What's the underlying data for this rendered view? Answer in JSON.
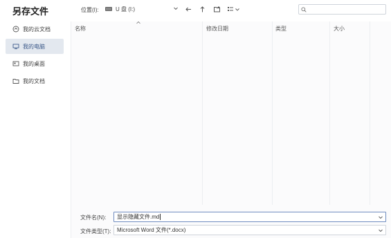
{
  "dialog": {
    "title": "另存文件"
  },
  "sidebar": {
    "items": [
      {
        "label": "我的云文档",
        "icon": "cloud-icon",
        "active": false
      },
      {
        "label": "我的电脑",
        "icon": "computer-icon",
        "active": true
      },
      {
        "label": "我的桌面",
        "icon": "desktop-icon",
        "active": false
      },
      {
        "label": "我的文档",
        "icon": "folder-icon",
        "active": false
      }
    ]
  },
  "toolbar": {
    "location_label": "位置(I):",
    "location_value": "U 盘 (I:)",
    "search_placeholder": ""
  },
  "columns": [
    {
      "label": "名称"
    },
    {
      "label": "修改日期"
    },
    {
      "label": "类型"
    },
    {
      "label": "大小"
    }
  ],
  "bottom": {
    "filename_label": "文件名(N):",
    "filename_value": "显示隐藏文件.md",
    "filetype_label": "文件类型(T):",
    "filetype_value": "Microsoft Word 文件(*.docx)"
  },
  "colors": {
    "active_bg": "#e3e8ef",
    "active_text": "#3d5a8a",
    "focus_border": "#6e8bbf"
  }
}
